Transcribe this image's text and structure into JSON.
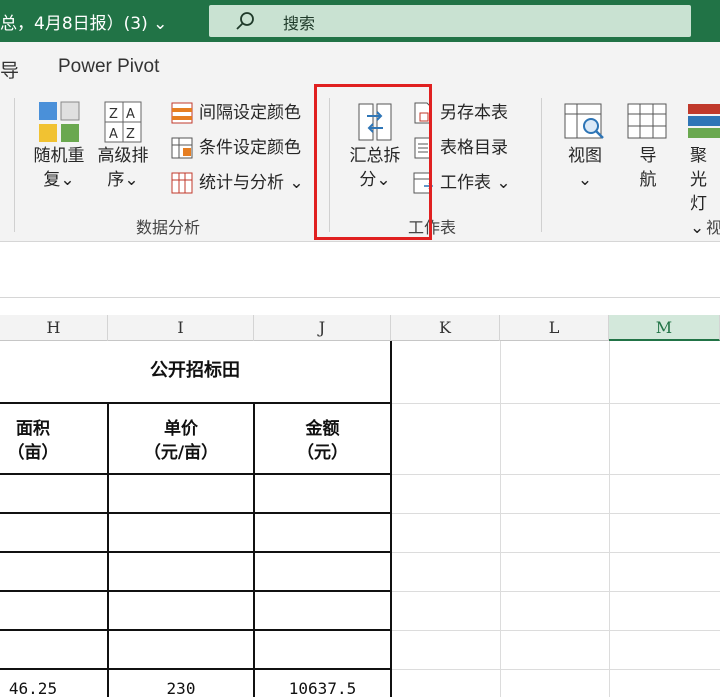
{
  "titlebar": {
    "doc_title": "总，4月8日报）(3)  ⌄",
    "search_label": "搜索",
    "background_color": "#217346"
  },
  "tabs": [
    "导",
    "Power Pivot"
  ],
  "ribbon": {
    "data_analysis": {
      "group_label": "数据分析",
      "random_btn": [
        "随机重",
        "复⌄"
      ],
      "sort_btn": [
        "高级排",
        "序⌄"
      ],
      "small_items": [
        "间隔设定颜色",
        "条件设定颜色",
        "统计与分析 ⌄"
      ]
    },
    "worksheet": {
      "group_label": "工作表",
      "split_btn": [
        "汇总拆",
        "分⌄"
      ],
      "small_items": [
        "另存本表",
        "表格目录",
        "工作表 ⌄"
      ]
    },
    "view": {
      "view_btn": [
        "视图",
        "⌄"
      ],
      "nav_btn": [
        "导",
        "航"
      ],
      "spotlight_btn": [
        "聚光",
        "灯⌄"
      ],
      "group_label_partial": "视"
    },
    "highlight_color": "#e02020"
  },
  "columns": [
    "H",
    "I",
    "J",
    "K",
    "L",
    "M"
  ],
  "selected_column": "M",
  "sheet": {
    "merged_title": "公开招标田",
    "headers": [
      [
        "面积",
        "（亩）"
      ],
      [
        "单价",
        "（元/亩）"
      ],
      [
        "金额",
        "（元）"
      ]
    ],
    "last_row": [
      "46.25",
      "230",
      "10637.5"
    ]
  }
}
